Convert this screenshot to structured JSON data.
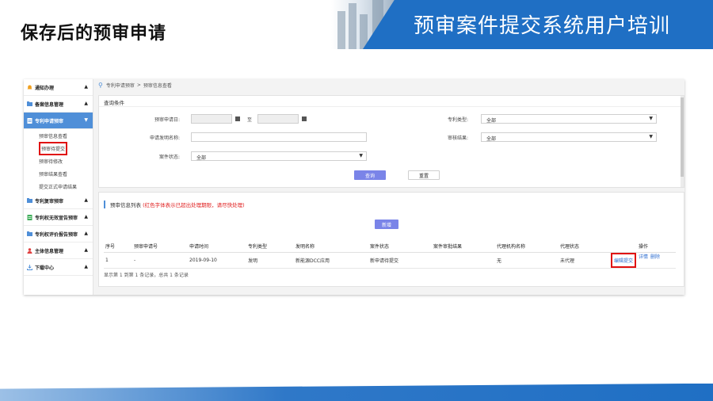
{
  "slide": {
    "title": "保存后的预审申请",
    "banner_title": "预审案件提交系统用户培训",
    "accent_color": "#1f6fc4"
  },
  "sidebar": {
    "groups": [
      {
        "label": "通知办理",
        "icon": "bell-icon",
        "expanded": true
      },
      {
        "label": "备案信息管理",
        "icon": "folder-icon",
        "expanded": true
      },
      {
        "label": "专利申请预审",
        "icon": "document-icon",
        "expanded": true,
        "active": true
      },
      {
        "label": "专利复审预审",
        "icon": "folder-icon",
        "expanded": true
      },
      {
        "label": "专利权无效宣告预审",
        "icon": "document-icon",
        "expanded": true
      },
      {
        "label": "专利权评价报告预审",
        "icon": "folder-icon",
        "expanded": true
      },
      {
        "label": "主体信息管理",
        "icon": "user-icon",
        "expanded": true
      },
      {
        "label": "下载中心",
        "icon": "download-icon",
        "expanded": true
      }
    ],
    "sub_items": [
      "预审信息查看",
      "预审待提交",
      "预审待修改",
      "预审结果查看",
      "提交正式申请结果"
    ]
  },
  "breadcrumb": {
    "root": "专利申请预审",
    "separator": ">",
    "current": "预审信息查看"
  },
  "query": {
    "title": "查询条件",
    "date_label": "预审申请日:",
    "to_label": "至",
    "name_label": "申请发明名称:",
    "case_status_label": "案件状态:",
    "case_status_value": "全部",
    "patent_type_label": "专利类型:",
    "patent_type_value": "全部",
    "review_result_label": "审核结果:",
    "review_result_value": "全部",
    "query_button": "查询",
    "reset_button": "重置"
  },
  "list": {
    "title": "预审信息列表",
    "note": "(红色字体表示已超出处理期限，请尽快处理)",
    "new_button": "新增",
    "columns": [
      "序号",
      "预审申请号",
      "申请时间",
      "专利类型",
      "发明名称",
      "案件状态",
      "案件审批结果",
      "代理机构名称",
      "代理状态",
      "操作"
    ],
    "rows": [
      {
        "cells": [
          "1",
          "-",
          "2019-09-10",
          "发明",
          "新能源DCC应用",
          "新申请待提交",
          "",
          "无",
          "未代理"
        ],
        "actions": [
          "编辑提交",
          "详情",
          "删除"
        ]
      }
    ],
    "pager": "显示第 1 到第 1 条记录，总共 1 条记录"
  }
}
